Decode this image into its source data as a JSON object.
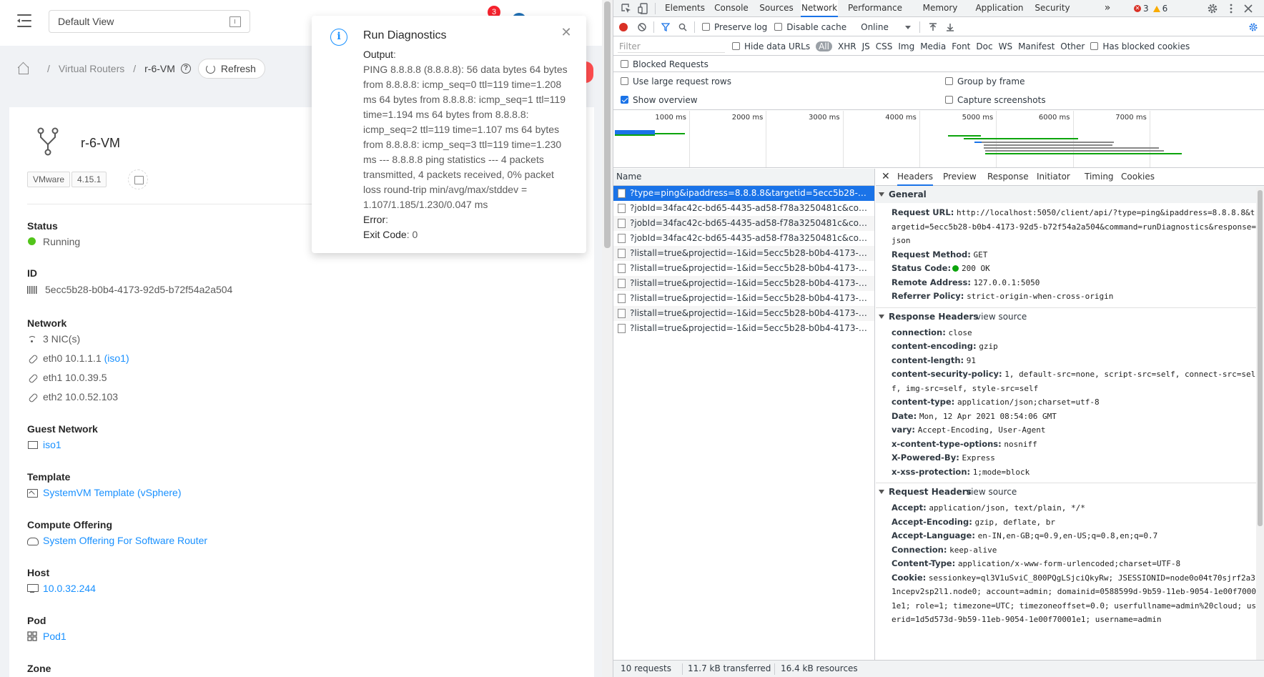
{
  "app": {
    "view_select": "Default View",
    "notification_count": "3",
    "breadcrumb": {
      "item1": "Virtual Routers",
      "current": "r-6-VM"
    },
    "refresh_label": "Refresh",
    "resource": {
      "name": "r-6-VM",
      "tags": [
        "VMware",
        "4.15.1"
      ],
      "fields": {
        "status": {
          "label": "Status",
          "value": "Running"
        },
        "id": {
          "label": "ID",
          "value": "5ecc5b28-b0b4-4173-92d5-b72f54a2a504"
        },
        "network": {
          "label": "Network",
          "nics": "3 NIC(s)",
          "eth0": {
            "text": "eth0 10.1.1.1",
            "link": "(iso1)"
          },
          "eth1": "eth1 10.0.39.5",
          "eth2": "eth2 10.0.52.103"
        },
        "guest_network": {
          "label": "Guest Network",
          "value": "iso1"
        },
        "template": {
          "label": "Template",
          "value": "SystemVM Template (vSphere)"
        },
        "compute_offering": {
          "label": "Compute Offering",
          "value": "System Offering For Software Router"
        },
        "host": {
          "label": "Host",
          "value": "10.0.32.244"
        },
        "pod": {
          "label": "Pod",
          "value": "Pod1"
        },
        "zone": {
          "label": "Zone"
        }
      }
    },
    "notification": {
      "title": "Run Diagnostics",
      "output_label": "Output",
      "output_text": "PING 8.8.8.8 (8.8.8.8): 56 data bytes 64 bytes from 8.8.8.8: icmp_seq=0 ttl=119 time=1.208 ms 64 bytes from 8.8.8.8: icmp_seq=1 ttl=119 time=1.194 ms 64 bytes from 8.8.8.8: icmp_seq=2 ttl=119 time=1.107 ms 64 bytes from 8.8.8.8: icmp_seq=3 ttl=119 time=1.230 ms --- 8.8.8.8 ping statistics --- 4 packets transmitted, 4 packets received, 0% packet loss round-trip min/avg/max/stddev = 1.107/1.185/1.230/0.047 ms",
      "error_label": "Error",
      "error_text": "",
      "exit_label": "Exit Code",
      "exit_value": "0"
    }
  },
  "devtools": {
    "tabs": [
      "Elements",
      "Console",
      "Sources",
      "Network",
      "Performance",
      "Memory",
      "Application",
      "Security"
    ],
    "active_tab": "Network",
    "more_tabs": "»",
    "error_count": "3",
    "warning_count": "6",
    "toolbar": {
      "preserve_log": "Preserve log",
      "disable_cache": "Disable cache",
      "throttle": "Online"
    },
    "filter": {
      "placeholder": "Filter",
      "hide_data_urls": "Hide data URLs",
      "types": [
        "All",
        "XHR",
        "JS",
        "CSS",
        "Img",
        "Media",
        "Font",
        "Doc",
        "WS",
        "Manifest",
        "Other"
      ],
      "has_blocked_cookies": "Has blocked cookies",
      "blocked_requests": "Blocked Requests"
    },
    "settings": {
      "large_rows": "Use large request rows",
      "group_by_frame": "Group by frame",
      "show_overview": "Show overview",
      "capture_screenshots": "Capture screenshots"
    },
    "timeline_labels": [
      "1000 ms",
      "2000 ms",
      "3000 ms",
      "4000 ms",
      "5000 ms",
      "6000 ms",
      "7000 ms"
    ],
    "list_header": "Name",
    "requests": [
      "?type=ping&ipaddress=8.8.8.8&targetid=5ecc5b28-b0b...b7...",
      "?jobId=34fac42c-bd65-4435-ad58-f78a3250481c&command...",
      "?jobId=34fac42c-bd65-4435-ad58-f78a3250481c&command...",
      "?jobId=34fac42c-bd65-4435-ad58-f78a3250481c&command...",
      "?listall=true&projectid=-1&id=5ecc5b28-b0b4-4173-9...e=1...",
      "?listall=true&projectid=-1&id=5ecc5b28-b0b4-4173-9...e=1...",
      "?listall=true&projectid=-1&id=5ecc5b28-b0b4-4173-9...e=1...",
      "?listall=true&projectid=-1&id=5ecc5b28-b0b4-4173-9...e=1...",
      "?listall=true&projectid=-1&id=5ecc5b28-b0b4-4173-9...e=1...",
      "?listall=true&projectid=-1&id=5ecc5b28-b0b4-4173-9...e=1..."
    ],
    "detail_tabs": [
      "Headers",
      "Preview",
      "Response",
      "Initiator",
      "Timing",
      "Cookies"
    ],
    "general": {
      "title": "General",
      "request_url_k": "Request URL:",
      "request_url_v": "http://localhost:5050/client/api/?type=ping&ipaddress=8.8.8.8&targetid=5ecc5b28-b0b4-4173-92d5-b72f54a2a504&command=runDiagnostics&response=json",
      "method_k": "Request Method:",
      "method_v": "GET",
      "status_k": "Status Code:",
      "status_v": "200 OK",
      "remote_k": "Remote Address:",
      "remote_v": "127.0.0.1:5050",
      "referrer_k": "Referrer Policy:",
      "referrer_v": "strict-origin-when-cross-origin"
    },
    "response_headers": {
      "title": "Response Headers",
      "view_source": "view source",
      "items": [
        {
          "k": "connection:",
          "v": "close"
        },
        {
          "k": "content-encoding:",
          "v": "gzip"
        },
        {
          "k": "content-length:",
          "v": "91"
        },
        {
          "k": "content-security-policy:",
          "v": "1, default-src=none, script-src=self, connect-src=self, img-src=self, style-src=self"
        },
        {
          "k": "content-type:",
          "v": "application/json;charset=utf-8"
        },
        {
          "k": "Date:",
          "v": "Mon, 12 Apr 2021 08:54:06 GMT"
        },
        {
          "k": "vary:",
          "v": "Accept-Encoding, User-Agent"
        },
        {
          "k": "x-content-type-options:",
          "v": "nosniff"
        },
        {
          "k": "X-Powered-By:",
          "v": "Express"
        },
        {
          "k": "x-xss-protection:",
          "v": "1;mode=block"
        }
      ]
    },
    "request_headers": {
      "title": "Request Headers",
      "view_source": "view source",
      "items": [
        {
          "k": "Accept:",
          "v": "application/json, text/plain, */*"
        },
        {
          "k": "Accept-Encoding:",
          "v": "gzip, deflate, br"
        },
        {
          "k": "Accept-Language:",
          "v": "en-IN,en-GB;q=0.9,en-US;q=0.8,en;q=0.7"
        },
        {
          "k": "Connection:",
          "v": "keep-alive"
        },
        {
          "k": "Content-Type:",
          "v": "application/x-www-form-urlencoded;charset=UTF-8"
        },
        {
          "k": "Cookie:",
          "v": "sessionkey=ql3V1uSviC_800PQgLSjciQkyRw; JSESSIONID=node0o04t70sjrf2a31ncepv2sp2l1.node0; account=admin; domainid=0588599d-9b59-11eb-9054-1e00f70001e1; role=1; timezone=UTC; timezoneoffset=0.0; userfullname=admin%20cloud; userid=1d5d573d-9b59-11eb-9054-1e00f70001e1; username=admin"
        }
      ]
    },
    "status_bar": {
      "requests": "10 requests",
      "transferred": "11.7 kB transferred",
      "resources": "16.4 kB resources"
    }
  }
}
